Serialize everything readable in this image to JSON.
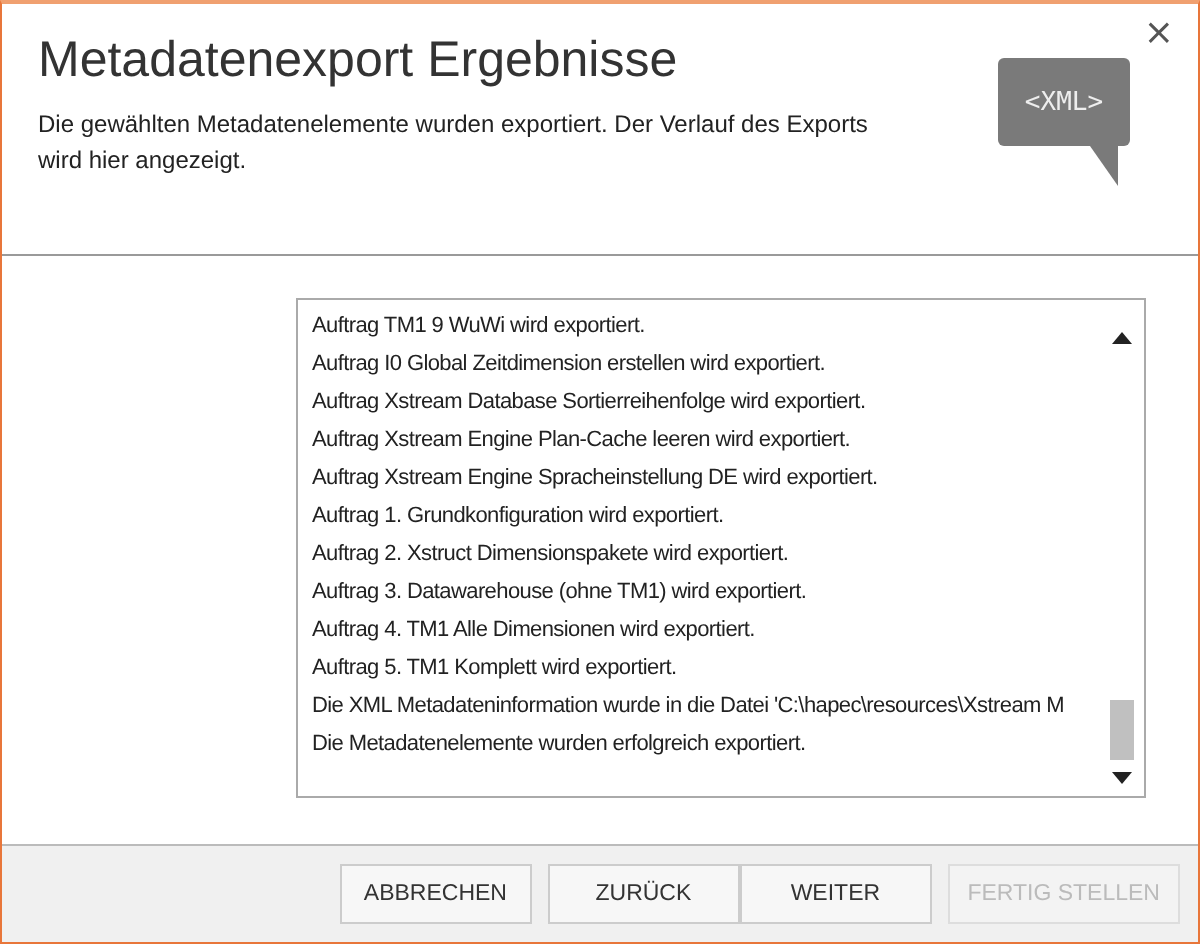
{
  "window": {
    "title": "Metadatenexport Ergebnisse",
    "subtitle": "Die gewählten Metadatenelemente wurden exportiert. Der Verlauf des Exports wird hier angezeigt.",
    "close": "×"
  },
  "logo": {
    "label": "<XML>"
  },
  "log": {
    "lines": [
      "Auftrag TM1 9 WuWi wird exportiert.",
      "Auftrag I0 Global Zeitdimension erstellen wird exportiert.",
      "Auftrag Xstream Database Sortierreihenfolge wird exportiert.",
      "Auftrag Xstream Engine Plan-Cache leeren wird exportiert.",
      "Auftrag Xstream Engine Spracheinstellung DE wird exportiert.",
      "Auftrag 1. Grundkonfiguration wird exportiert.",
      "Auftrag 2. Xstruct Dimensionspakete wird exportiert.",
      "Auftrag 3. Datawarehouse (ohne TM1) wird exportiert.",
      "Auftrag 4. TM1 Alle Dimensionen wird exportiert.",
      "Auftrag 5. TM1 Komplett wird exportiert.",
      "Die XML Metadateninformation wurde in die Datei 'C:\\hapec\\resources\\Xstream M",
      "Die Metadatenelemente wurden erfolgreich exportiert."
    ]
  },
  "buttons": [
    {
      "label": "ABBRECHEN",
      "disabled": false
    },
    {
      "label": "ZURÜCK",
      "disabled": false
    },
    {
      "label": "WEITER",
      "disabled": false
    },
    {
      "label": "FERTIG STELLEN",
      "disabled": true
    }
  ]
}
